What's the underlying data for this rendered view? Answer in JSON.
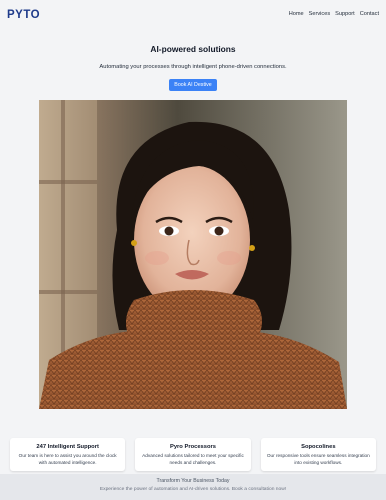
{
  "header": {
    "logo": "PYTO",
    "nav": [
      "Home",
      "Services",
      "Support",
      "Contact"
    ]
  },
  "hero": {
    "title": "AI-powered solutions",
    "subtitle": "Automating your processes through intelligent phone-driven connections.",
    "cta_label": "Book AI Destive"
  },
  "cards": [
    {
      "title": "247 Intelligent Support",
      "text": "Our team is here to assist you around the clock with automated intelligence."
    },
    {
      "title": "Pyro Processors",
      "text": "Advanced solutions tailored to meet your specific needs and challenges."
    },
    {
      "title": "Sopocolines",
      "text": "Our responsive tools ensure seamless integration into existing workflows."
    }
  ],
  "footer": {
    "title": "Transform Your Business Today",
    "text": "Experience the power of automation and AI-driven solutions. Book a consultation now!"
  },
  "colors": {
    "brand": "#1e3a8a",
    "accent": "#3b82f6",
    "background": "#f3f4f6"
  }
}
